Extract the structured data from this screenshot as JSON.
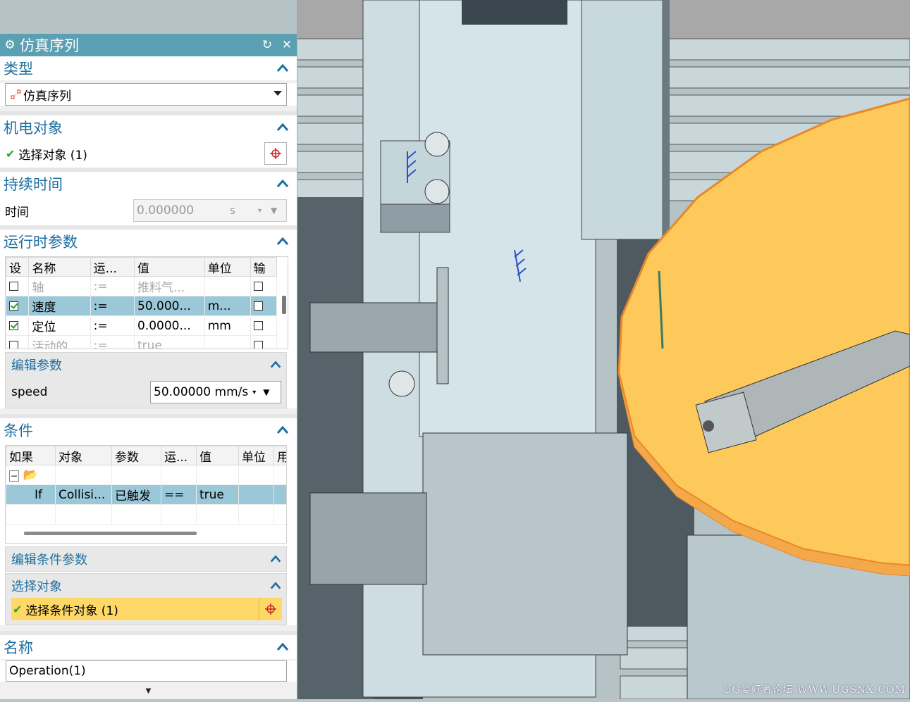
{
  "panel": {
    "title": "仿真序列",
    "reset_icon": "reset-icon",
    "close_icon": "close-icon"
  },
  "type_section": {
    "title": "类型",
    "selected": "仿真序列"
  },
  "mech_section": {
    "title": "机电对象",
    "select_label": "选择对象 (1)"
  },
  "duration_section": {
    "title": "持续时间",
    "time_label": "时间",
    "time_value": "0.000000",
    "time_unit": "s"
  },
  "runtime_section": {
    "title": "运行时参数",
    "columns": [
      "设",
      "名称",
      "运...",
      "值",
      "单位",
      "输"
    ],
    "rows": [
      {
        "set": false,
        "name": "轴",
        "op": ":=",
        "value": "推料气...",
        "unit": "",
        "out": false,
        "state": "dim"
      },
      {
        "set": true,
        "name": "速度",
        "op": ":=",
        "value": "50.000...",
        "unit": "m...",
        "out": false,
        "state": "selected"
      },
      {
        "set": true,
        "name": "定位",
        "op": ":=",
        "value": "0.0000...",
        "unit": "mm",
        "out": false,
        "state": "normal"
      },
      {
        "set": false,
        "name": "活动的",
        "op": ":=",
        "value": "true",
        "unit": "",
        "out": false,
        "state": "dim"
      }
    ],
    "edit_params": {
      "title": "编辑参数",
      "param_label": "speed",
      "param_value": "50.00000 mm/s"
    }
  },
  "condition_section": {
    "title": "条件",
    "columns": [
      "如果",
      "对象",
      "参数",
      "运...",
      "值",
      "单位",
      "用"
    ],
    "row": {
      "if": "If",
      "object": "Collisi...",
      "param": "已触发",
      "op": "==",
      "value": "true",
      "unit": ""
    },
    "edit_condition_title": "编辑条件参数",
    "select_object_title": "选择对象",
    "select_condition_label": "选择条件对象 (1)"
  },
  "name_section": {
    "title": "名称",
    "value": "Operation(1)"
  },
  "watermark": "UG爱好者论坛 WWW.UGSNX.COM",
  "colors": {
    "title_bar": "#5b9fb3",
    "section_title": "#1e6fa0",
    "selection": "#9ac8d8",
    "highlight": "#ffd968",
    "disk": "#fdc95a"
  }
}
